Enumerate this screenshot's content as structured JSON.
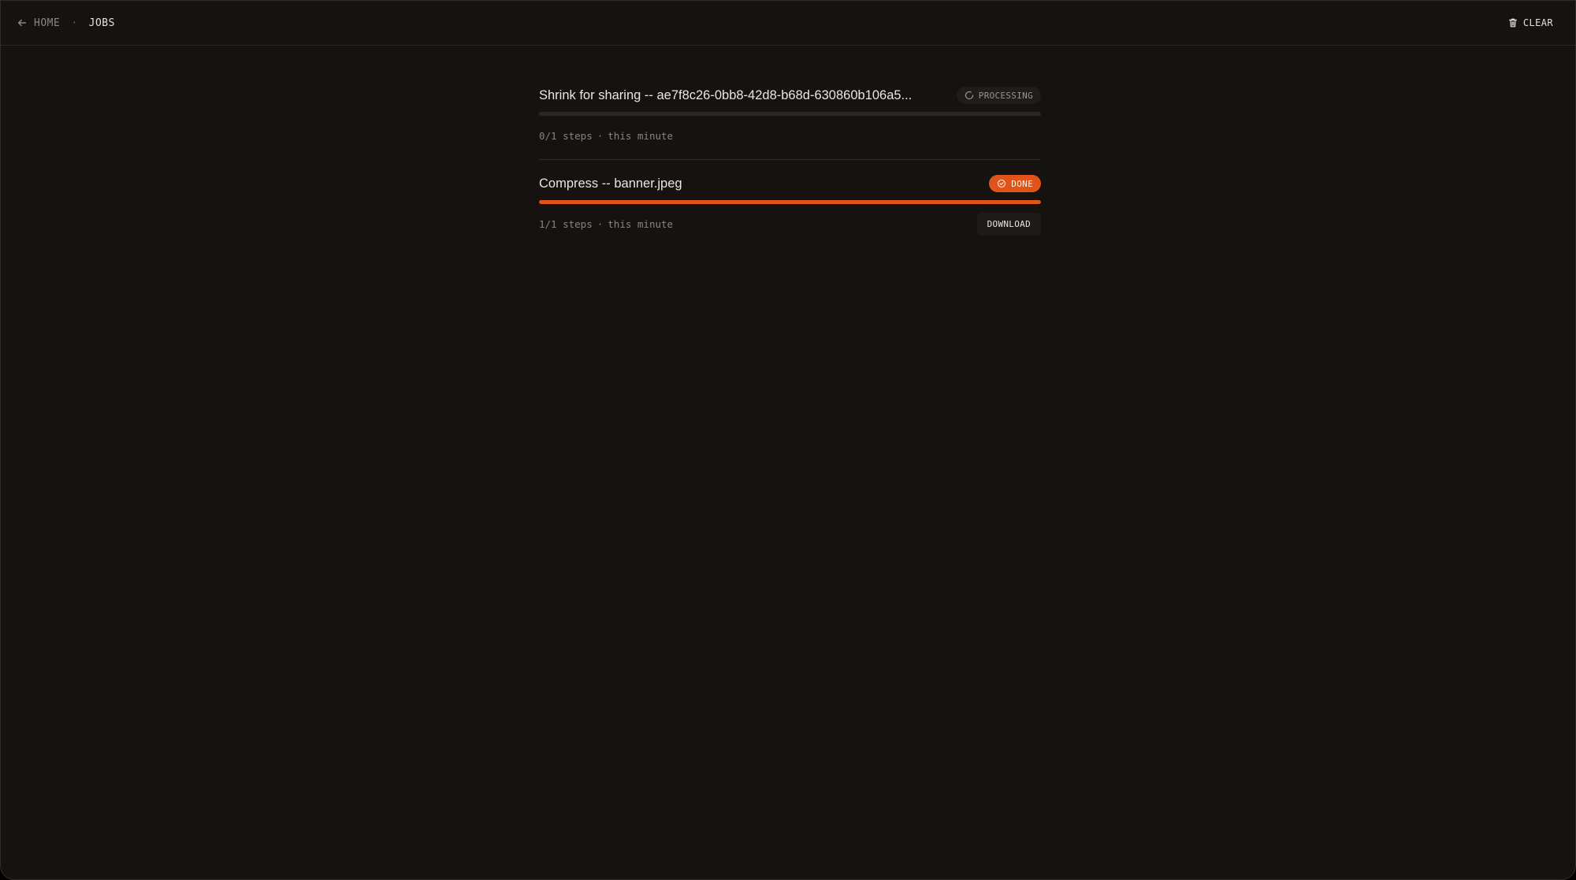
{
  "breadcrumb": {
    "home_label": "HOME",
    "separator": "·",
    "current_label": "JOBS"
  },
  "toolbar": {
    "clear_label": "CLEAR"
  },
  "colors": {
    "accent": "#e0541a",
    "background": "#15120f"
  },
  "jobs": [
    {
      "title": "Shrink for sharing -- ae7f8c26-0bb8-42d8-b68d-630860b106a5...",
      "status": "PROCESSING",
      "status_icon": "spinner-icon",
      "progress": 0,
      "steps": "0/1 steps",
      "time": "this minute"
    },
    {
      "title": "Compress -- banner.jpeg",
      "status": "DONE",
      "status_icon": "check-circle-icon",
      "progress": 1,
      "steps": "1/1 steps",
      "time": "this minute",
      "action_label": "DOWNLOAD"
    }
  ]
}
